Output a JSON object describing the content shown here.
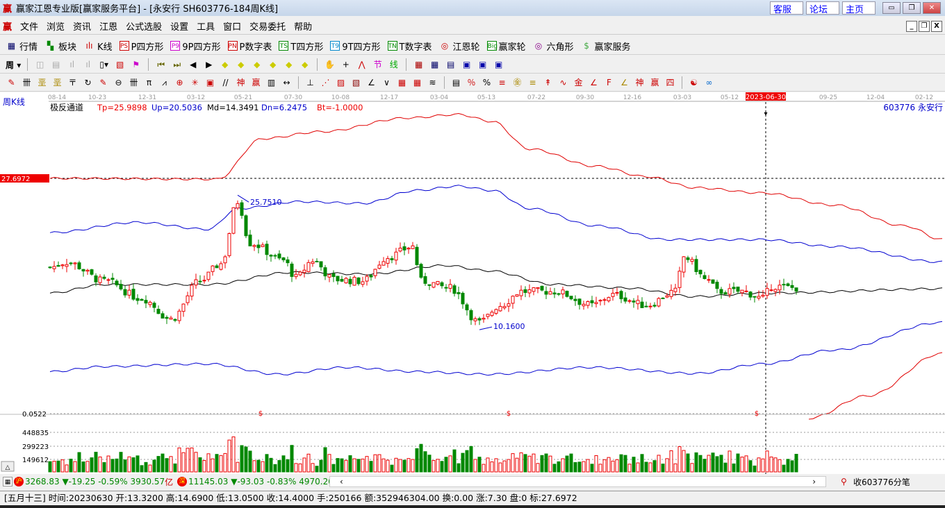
{
  "window": {
    "title": "赢家江恩专业版[赢家服务平台] - [永安行  SH603776-184周K线]",
    "links": [
      "客服",
      "论坛",
      "主页"
    ]
  },
  "menu": [
    "文件",
    "浏览",
    "资讯",
    "江恩",
    "公式选股",
    "设置",
    "工具",
    "窗口",
    "交易委托",
    "帮助"
  ],
  "toolbar1": [
    {
      "icon": "grid-icon",
      "label": "行情"
    },
    {
      "icon": "blocks-icon",
      "label": "板块"
    },
    {
      "icon": "kline-icon",
      "label": "K线"
    },
    {
      "icon": "PS",
      "label": "P四方形"
    },
    {
      "icon": "P9",
      "label": "9P四方形"
    },
    {
      "icon": "PN",
      "label": "P数字表"
    },
    {
      "icon": "TS",
      "label": "T四方形"
    },
    {
      "icon": "T9",
      "label": "9T四方形"
    },
    {
      "icon": "TN",
      "label": "T数字表"
    },
    {
      "icon": "target-icon",
      "label": "江恩轮"
    },
    {
      "icon": "Big",
      "label": "赢家轮"
    },
    {
      "icon": "hexagon-icon",
      "label": "六角形"
    },
    {
      "icon": "dollar-icon",
      "label": "赢家服务"
    }
  ],
  "period_button": "周",
  "chart": {
    "period_label": "周K线",
    "indicator_name": "极反通道",
    "params": {
      "tp": "Tp=25.9898",
      "up": "Up=20.5036",
      "md": "Md=14.3491",
      "dn": "Dn=6.2475",
      "bt": "Bt=-1.0000"
    },
    "stock_label": "603776  永安行",
    "date_ticks": [
      "08-14",
      "10-23",
      "12-31",
      "03-12",
      "05-21",
      "07-30",
      "10-08",
      "12-17",
      "03-04",
      "05-13",
      "07-22",
      "09-30",
      "12-16",
      "03-03",
      "05-12",
      "2023-06-30",
      "09-25",
      "12-04",
      "02-12"
    ],
    "cursor_price": "27.6972",
    "high_label": "25.7510",
    "low_label": "10.1600",
    "volume_ticks": [
      "0.0522",
      "448835",
      "299223",
      "149612"
    ],
    "colors": {
      "up": "#e00000",
      "down": "#008000",
      "top": "#e00000",
      "upper": "#0000d0",
      "mid": "#000000"
    }
  },
  "chart_data": {
    "type": "candlestick",
    "price_range": [
      -5,
      37
    ],
    "close_keyframes": [
      [
        0,
        17.4
      ],
      [
        4,
        18.0
      ],
      [
        13,
        15.8
      ],
      [
        22,
        13.8
      ],
      [
        29,
        11.4
      ],
      [
        36,
        15.8
      ],
      [
        41,
        17.8
      ],
      [
        45,
        25.0
      ],
      [
        48,
        20.2
      ],
      [
        56,
        18.2
      ],
      [
        59,
        16.2
      ],
      [
        63,
        18.2
      ],
      [
        68,
        16.0
      ],
      [
        75,
        15.8
      ],
      [
        81,
        18.6
      ],
      [
        87,
        19.8
      ],
      [
        89,
        15.8
      ],
      [
        96,
        15.0
      ],
      [
        103,
        11.0
      ],
      [
        108,
        13.0
      ],
      [
        113,
        14.6
      ],
      [
        121,
        14.6
      ],
      [
        130,
        13.0
      ],
      [
        135,
        14.2
      ],
      [
        143,
        13.0
      ],
      [
        150,
        14.6
      ],
      [
        152,
        18.6
      ],
      [
        158,
        15.8
      ],
      [
        160,
        14.6
      ],
      [
        166,
        14.6
      ],
      [
        171,
        13.8
      ],
      [
        173,
        15.2
      ],
      [
        179,
        15.0
      ]
    ],
    "lines": {
      "top": [
        [
          0,
          27.7
        ],
        [
          40,
          27.6
        ],
        [
          51,
          32.3
        ],
        [
          65,
          33.1
        ],
        [
          86,
          34.7
        ],
        [
          98,
          35.1
        ],
        [
          106,
          34.3
        ],
        [
          115,
          31.1
        ],
        [
          131,
          29.1
        ],
        [
          143,
          27.9
        ],
        [
          155,
          26.6
        ],
        [
          171,
          26.0
        ],
        [
          188,
          24.6
        ],
        [
          205,
          22.2
        ],
        [
          214,
          20.6
        ]
      ],
      "upper": [
        [
          0,
          21.4
        ],
        [
          21,
          22.6
        ],
        [
          38,
          21.8
        ],
        [
          45,
          24.2
        ],
        [
          60,
          25.0
        ],
        [
          75,
          24.8
        ],
        [
          88,
          26.3
        ],
        [
          98,
          26.8
        ],
        [
          106,
          26.3
        ],
        [
          115,
          24.2
        ],
        [
          131,
          22.2
        ],
        [
          148,
          20.6
        ],
        [
          171,
          20.6
        ],
        [
          188,
          19.8
        ],
        [
          214,
          18.0
        ]
      ],
      "mid": [
        [
          0,
          14.4
        ],
        [
          13,
          15.4
        ],
        [
          38,
          15.4
        ],
        [
          58,
          16.8
        ],
        [
          76,
          16.6
        ],
        [
          95,
          17.6
        ],
        [
          105,
          17.0
        ],
        [
          121,
          15.4
        ],
        [
          138,
          15.0
        ],
        [
          155,
          14.0
        ],
        [
          171,
          14.4
        ],
        [
          214,
          14.9
        ]
      ],
      "lower": [
        [
          0,
          5.3
        ],
        [
          13,
          5.9
        ],
        [
          38,
          6.2
        ],
        [
          55,
          5.0
        ],
        [
          71,
          5.8
        ],
        [
          88,
          5.3
        ],
        [
          105,
          5.0
        ],
        [
          130,
          5.8
        ],
        [
          155,
          5.1
        ],
        [
          171,
          6.2
        ],
        [
          188,
          7.8
        ],
        [
          214,
          11.0
        ]
      ],
      "bottom": [
        [
          182,
          -0.1
        ],
        [
          196,
          2.5
        ],
        [
          214,
          7.4
        ]
      ]
    }
  },
  "status": {
    "sh_label": "沪",
    "sh": "3268.83",
    "sh_chg": "▼-19.25",
    "sh_pct": "-0.59%",
    "sh_amt": "3930.57",
    "sh_unit": "亿",
    "sz_label": "深",
    "sz": "11145.03",
    "sz_chg": "▼-93.03",
    "sz_pct": "-0.83%",
    "sz_amt": "4970.20",
    "collect": "收603776分笔"
  },
  "info": "[五月十三] 时间:20230630 开:13.3200 高:14.6900 低:13.0500 收:14.4000 手:250166 额:352946304.00 换:0.00 涨:7.30 盘:0 标:27.6972"
}
